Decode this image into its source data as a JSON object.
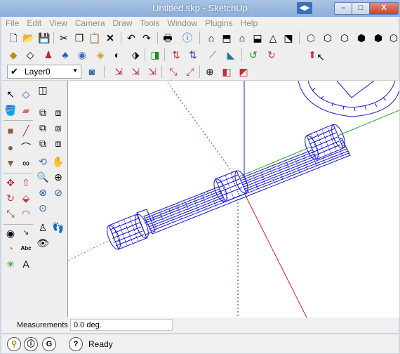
{
  "window": {
    "title": "Untitled.skp - SketchUp"
  },
  "menu": [
    "File",
    "Edit",
    "View",
    "Camera",
    "Draw",
    "Tools",
    "Window",
    "Plugins",
    "Help"
  ],
  "layers": {
    "current": "Layer0"
  },
  "measurements": {
    "label": "Measurements",
    "value": "0.0 deg."
  },
  "status": {
    "text": "Ready"
  },
  "colors": {
    "model_edges": "#1616d8",
    "axis_red": "#cc2222",
    "axis_green": "#22aa22",
    "axis_blue": "#2222cc",
    "titlebar": "#9bb8de"
  }
}
